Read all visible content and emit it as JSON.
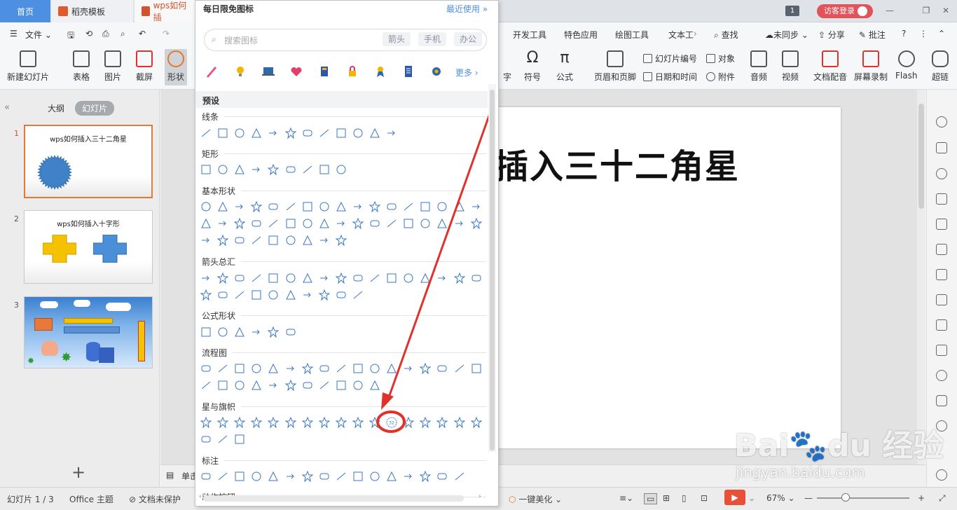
{
  "tabs": [
    {
      "label": "首页"
    },
    {
      "label": "稻壳模板"
    },
    {
      "label": "wps如何插"
    }
  ],
  "titlebar": {
    "page_badge": "1",
    "login": "访客登录"
  },
  "menu": {
    "file": "文件",
    "items": [
      "开发工具",
      "特色应用",
      "绘图工具",
      "文本工"
    ],
    "search": "查找",
    "sync": "未同步",
    "share": "分享",
    "comment": "批注",
    "help": "?"
  },
  "ribbon": {
    "new_slide": "新建幻灯片",
    "table": "表格",
    "picture": "图片",
    "screenshot": "截屏",
    "shape": "形状",
    "zi": "字",
    "symbol": "符号",
    "formula": "公式",
    "header_footer": "页眉和页脚",
    "slide_number": "幻灯片编号",
    "object": "对象",
    "datetime": "日期和时间",
    "attachment": "附件",
    "audio": "音频",
    "video": "视频",
    "narration": "文档配音",
    "screen_record": "屏幕录制",
    "flash": "Flash",
    "hyperlink": "超链"
  },
  "leftpane": {
    "outline_tab": "大纲",
    "slides_tab": "幻灯片",
    "slides": [
      {
        "number": "1",
        "title": "wps如何插入三十二角星"
      },
      {
        "number": "2",
        "title": "wps如何插入十字形"
      },
      {
        "number": "3",
        "title": ""
      }
    ],
    "add_button": "+"
  },
  "slide": {
    "title": "插入三十二角星"
  },
  "notes": {
    "label": "单击"
  },
  "panel": {
    "header": "每日限免图标",
    "recent": "最近使用",
    "search_placeholder": "搜索图标",
    "chips": [
      "箭头",
      "手机",
      "办公"
    ],
    "more": "更多",
    "preset": "预设",
    "sections": [
      "线条",
      "矩形",
      "基本形状",
      "箭头总汇",
      "公式形状",
      "流程图",
      "星与旗帜",
      "标注",
      "动作按钮"
    ],
    "highlighted_shape": "32-point-star"
  },
  "statusbar": {
    "slide_info": "幻灯片 1 / 3",
    "theme": "Office 主题",
    "protect": "文档未保护",
    "beautify": "一键美化",
    "zoom": "67%"
  },
  "watermark": {
    "brand": "Bai du 经验",
    "url": "jingyan.baidu.com"
  },
  "colors": {
    "accent": "#4d8fe1",
    "annotation": "#e0312b",
    "shape_outline": "#3a76c4"
  }
}
